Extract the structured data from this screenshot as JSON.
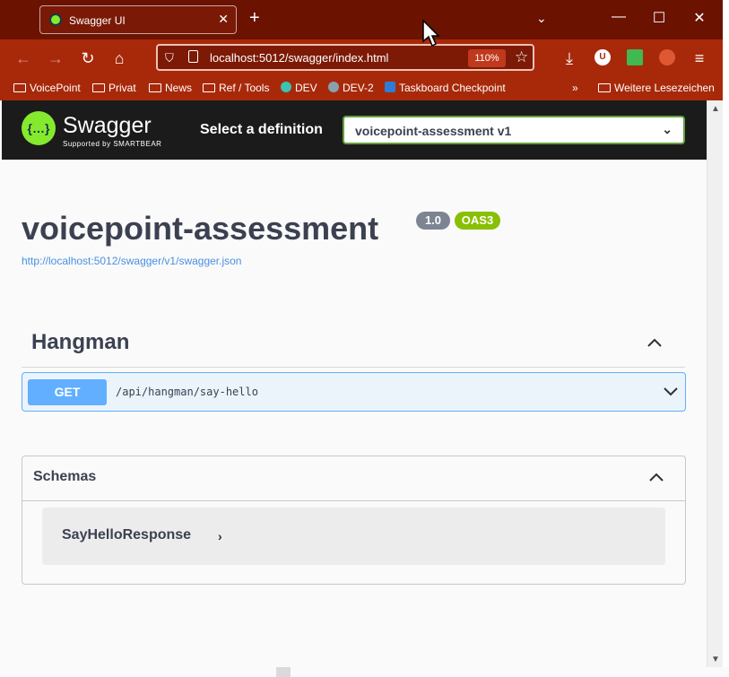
{
  "browser": {
    "tab_title": "Swagger UI",
    "tab_close": "✕",
    "new_tab": "+",
    "tab_list": "⌄",
    "window_controls": {
      "minimize": "—",
      "maximize": "☐",
      "close": "✕"
    },
    "nav": {
      "back": "←",
      "forward": "→",
      "reload": "↻",
      "home": "⌂"
    },
    "url": "localhost:5012/swagger/index.html",
    "zoom": "110%",
    "bookmark_star": "☆",
    "toolbar_icons": {
      "download": "⤓",
      "menu": "≡"
    },
    "extensions": [
      {
        "label": "U",
        "color": "#ffffff",
        "text_color": "#a8290a"
      },
      {
        "label": "",
        "color": "#3fb950",
        "text_color": "#ffffff"
      },
      {
        "label": "",
        "color": "#de5833",
        "text_color": "#ffffff"
      }
    ],
    "bookmarks": [
      {
        "label": "VoicePoint",
        "icon": "folder-icon"
      },
      {
        "label": "Privat",
        "icon": "folder-icon"
      },
      {
        "label": "News",
        "icon": "folder-icon"
      },
      {
        "label": "Ref / Tools",
        "icon": "folder-icon"
      },
      {
        "label": "DEV",
        "icon": "globe-icon"
      },
      {
        "label": "DEV-2",
        "icon": "gear-icon"
      },
      {
        "label": "Taskboard Checkpoint",
        "icon": "azure-icon"
      }
    ],
    "more_bookmarks": "Weitere Lesezeichen",
    "overflow": "»"
  },
  "swagger": {
    "logo_glyph": "{…}",
    "logo_name": "Swagger",
    "logo_sub": "Supported by SMARTBEAR",
    "definition_label": "Select a definition",
    "definition_value": "voicepoint-assessment v1",
    "chevron": "⌄"
  },
  "info": {
    "title": "voicepoint-assessment",
    "version": "1.0",
    "oas": "OAS3",
    "spec_url": "http://localhost:5012/swagger/v1/swagger.json"
  },
  "tags": [
    {
      "name": "Hangman",
      "operations": [
        {
          "method": "GET",
          "path": "/api/hangman/say-hello"
        }
      ]
    }
  ],
  "schemas": {
    "title": "Schemas",
    "items": [
      {
        "name": "SayHelloResponse",
        "expand": "›"
      }
    ]
  },
  "colors": {
    "get": "#61affe",
    "get_bg": "#ebf3fb",
    "oas": "#89bf04",
    "version": "#7d8492",
    "link": "#4990e2",
    "brand": "#85ea2d",
    "browser_titlebar": "#6b1200",
    "browser_toolbar": "#a8290a"
  }
}
